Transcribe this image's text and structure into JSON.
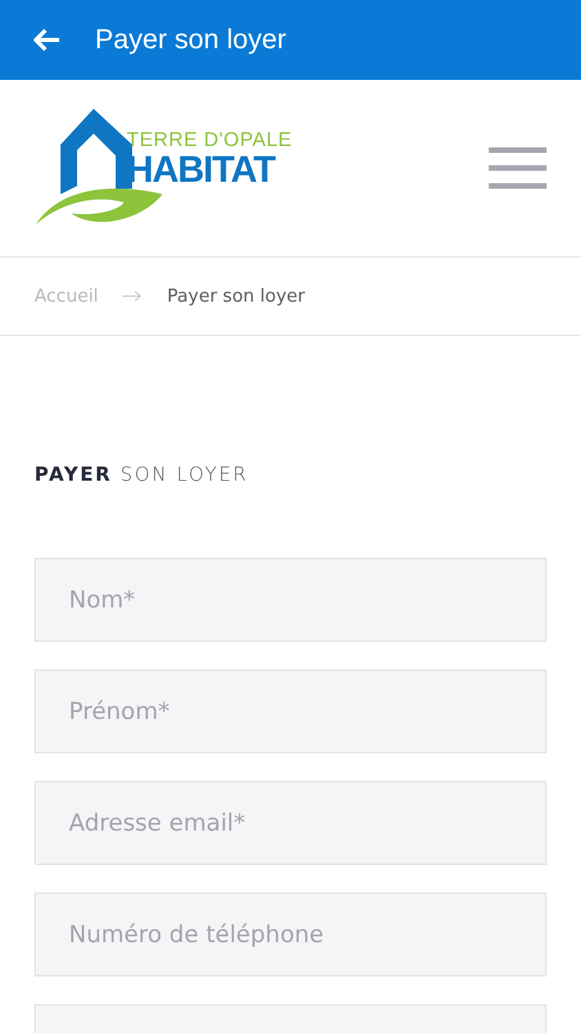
{
  "app_bar": {
    "title": "Payer son loyer"
  },
  "logo": {
    "tagline": "TERRE D'OPALE",
    "name": "HABITAT"
  },
  "breadcrumb": [
    {
      "label": "Accueil",
      "current": false
    },
    {
      "label": "Payer son loyer",
      "current": true
    }
  ],
  "heading": "**PAYER** SON LOYER",
  "fields": [
    {
      "kind": "input",
      "placeholder": "Nom*"
    },
    {
      "kind": "input",
      "placeholder": "Prénom*"
    },
    {
      "kind": "input",
      "placeholder": "Adresse email*"
    },
    {
      "kind": "input",
      "placeholder": "Numéro de téléphone"
    },
    {
      "kind": "input"
    }
  ]
}
